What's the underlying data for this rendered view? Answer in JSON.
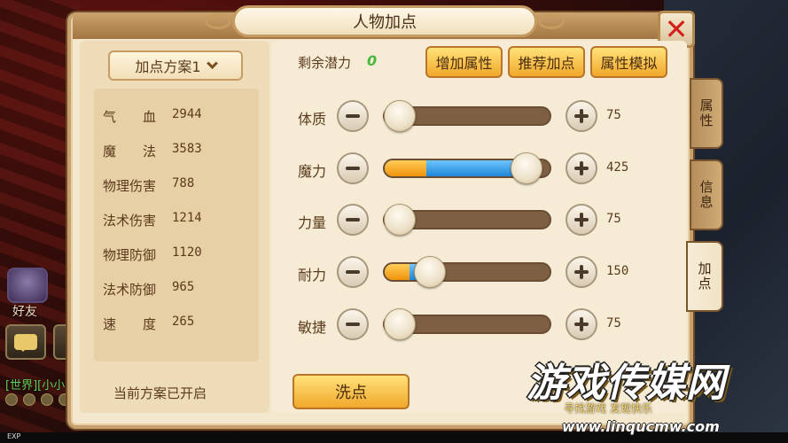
{
  "window": {
    "title": "人物加点"
  },
  "plan": {
    "selected": "加点方案1",
    "status": "当前方案已开启"
  },
  "stats": [
    {
      "name": "气　　血",
      "value": "2944"
    },
    {
      "name": "魔　　法",
      "value": "3583"
    },
    {
      "name": "物理伤害",
      "value": "788"
    },
    {
      "name": "法术伤害",
      "value": "1214"
    },
    {
      "name": "物理防御",
      "value": "1120"
    },
    {
      "name": "法术防御",
      "value": "965"
    },
    {
      "name": "速　　度",
      "value": "265"
    }
  ],
  "potential": {
    "label": "剩余潜力",
    "value": "0"
  },
  "toolbar": {
    "add": "增加属性",
    "recommend": "推荐加点",
    "simulate": "属性模拟"
  },
  "attributes": [
    {
      "name": "体质",
      "value": "75",
      "orange_fill": 0.0,
      "blue_fill": 0.0,
      "knob": 0.1
    },
    {
      "name": "魔力",
      "value": "425",
      "orange_fill": 0.25,
      "blue_fill": 0.85,
      "knob": 0.85
    },
    {
      "name": "力量",
      "value": "75",
      "orange_fill": 0.0,
      "blue_fill": 0.0,
      "knob": 0.1
    },
    {
      "name": "耐力",
      "value": "150",
      "orange_fill": 0.15,
      "blue_fill": 0.28,
      "knob": 0.28
    },
    {
      "name": "敏捷",
      "value": "75",
      "orange_fill": 0.0,
      "blue_fill": 0.0,
      "knob": 0.1
    }
  ],
  "wash": {
    "label": "洗点"
  },
  "tabs": [
    {
      "label": "属性",
      "active": false
    },
    {
      "label": "信息",
      "active": false
    },
    {
      "label": "加点",
      "active": true
    }
  ],
  "hud": {
    "friend": "好友",
    "world": "世界",
    "world_partial": "[小小",
    "exp": "EXP"
  },
  "watermark": {
    "title": "游戏传媒网",
    "slogan": "寻找游戏 发现快乐",
    "url": "www.linqucmw.com"
  },
  "colors": {
    "accent_gold": "#f1a82b",
    "bar_blue": "#1f86d6",
    "bar_orange": "#f1930c",
    "potential_green": "#48b83c",
    "close_red": "#d3201b"
  }
}
